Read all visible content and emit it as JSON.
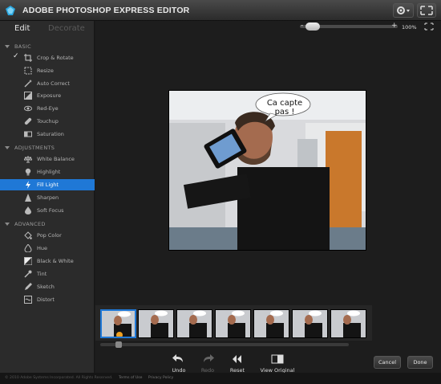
{
  "app": {
    "title": "ADOBE PHOTOSHOP EXPRESS EDITOR"
  },
  "modes": {
    "edit": "Edit",
    "decorate": "Decorate"
  },
  "sections": {
    "basic": "BASIC",
    "adjustments": "ADJUSTMENTS",
    "advanced": "ADVANCED"
  },
  "tools": {
    "crop": "Crop & Rotate",
    "resize": "Resize",
    "auto_correct": "Auto Correct",
    "exposure": "Exposure",
    "red_eye": "Red-Eye",
    "touchup": "Touchup",
    "saturation": "Saturation",
    "white_balance": "White Balance",
    "highlight": "Highlight",
    "fill_light": "Fill Light",
    "sharpen": "Sharpen",
    "soft_focus": "Soft Focus",
    "pop_color": "Pop Color",
    "hue": "Hue",
    "black_white": "Black & White",
    "tint": "Tint",
    "sketch": "Sketch",
    "distort": "Distort"
  },
  "zoom": {
    "minus": "-",
    "plus": "+",
    "percent": "100%",
    "level": 0.1
  },
  "photo": {
    "speech_bubble": "Ca capte pas !"
  },
  "actions": {
    "undo": "Undo",
    "redo": "Redo",
    "reset": "Reset",
    "view_original": "View Original"
  },
  "buttons": {
    "cancel": "Cancel",
    "done": "Done"
  },
  "footer": {
    "copyright": "© 2010 Adobe Systems Incorporated. All Rights Reserved.",
    "terms": "Terms of Use",
    "privacy": "Privacy Policy"
  },
  "colors": {
    "accent": "#1f78d6",
    "active_tool": "Fill Light"
  }
}
